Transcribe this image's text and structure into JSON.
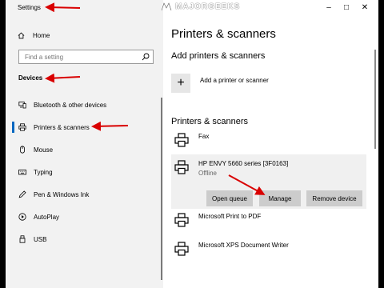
{
  "window": {
    "title": "Settings"
  },
  "watermark": "MAJORGEEKS",
  "nav": {
    "home": "Home",
    "search_placeholder": "Find a setting",
    "section": "Devices",
    "items": [
      {
        "label": "Bluetooth & other devices",
        "icon": "bluetooth-devices-icon"
      },
      {
        "label": "Printers & scanners",
        "icon": "printer-icon",
        "active": true
      },
      {
        "label": "Mouse",
        "icon": "mouse-icon"
      },
      {
        "label": "Typing",
        "icon": "keyboard-icon"
      },
      {
        "label": "Pen & Windows Ink",
        "icon": "pen-icon"
      },
      {
        "label": "AutoPlay",
        "icon": "autoplay-icon"
      },
      {
        "label": "USB",
        "icon": "usb-icon"
      }
    ]
  },
  "main": {
    "title": "Printers & scanners",
    "add_section": "Add printers & scanners",
    "add_label": "Add a printer or scanner",
    "list_section": "Printers & scanners",
    "printers": [
      {
        "name": "Fax",
        "status": ""
      },
      {
        "name": "HP ENVY 5660 series [3F0163]",
        "status": "Offline"
      },
      {
        "name": "Microsoft Print to PDF",
        "status": ""
      },
      {
        "name": "Microsoft XPS Document Writer",
        "status": ""
      }
    ],
    "buttons": {
      "open_queue": "Open queue",
      "manage": "Manage",
      "remove": "Remove device"
    }
  },
  "colors": {
    "annotation_arrow": "#d90000",
    "accent": "#0067c0"
  }
}
